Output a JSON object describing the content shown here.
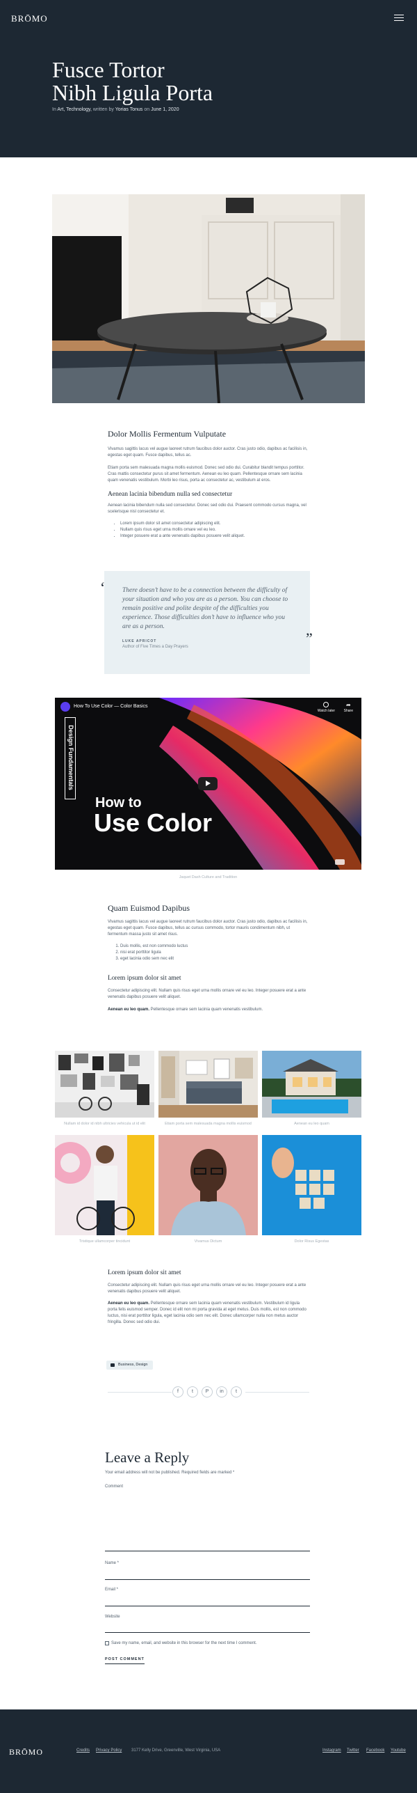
{
  "header": {
    "logo": "BRŌMO",
    "menu_icon": "hamburger-icon"
  },
  "post": {
    "title_line1": "Fusce Tortor",
    "title_line2": "Nibh Ligula Porta",
    "meta_in": "In",
    "categories": "Art, Technology,",
    "meta_written": "written by",
    "author": "Yorias Tonus",
    "meta_on": "on",
    "date": "June 1, 2020"
  },
  "section1": {
    "heading": "Dolor Mollis Fermentum Vulputate",
    "p1": "Vivamus sagittis lacus vel augue laoreet rutrum faucibus dolor auctor. Cras justo odio, dapibus ac facilisis in, egestas eget quam. Fusce dapibus, tellus ac.",
    "p2": "Etiam porta sem malesuada magna mollis euismod. Donec sed odio dui. Curabitur blandit tempus porttitor. Cras mattis consectetur purus sit amet fermentum. Aenean eu leo quam. Pellentesque ornare sem lacinia quam venenatis vestibulum. Morbi leo risus, porta ac consectetur ac, vestibulum at eros.",
    "subheading": "Aenean lacinia bibendum nulla sed consectetur",
    "p3": "Aenean lacinia bibendum nulla sed consectetur. Donec sed odio dui. Praesent commodo cursus magna, vel scelerisque nisl consectetur et.",
    "bullets": [
      "Lorem ipsum dolor sit amet consectetur adipiscing elit.",
      "Nullam quis risus eget urna mollis ornare vel eu leo.",
      "Integer posuere erat a ante venenatis dapibus posuere velit aliquet."
    ]
  },
  "quote": {
    "open_mark": "“",
    "close_mark": "”",
    "text": "There doesn’t have to be a connection between the difficulty of your situation and who you are as a person. You can choose to remain positive and polite despite of the difficulties you experience. Those difficulties don’t have to influence who you are as a person.",
    "name": "LUKE APRICOT",
    "role": "Author of Five Times a Day Prayers"
  },
  "video": {
    "channel_title": "How To Use Color — Color Basics",
    "watch_later": "Watch later",
    "share": "Share",
    "vertical_label": "Design Fundamentals",
    "overlay_line1": "How to",
    "overlay_line2": "Use Color",
    "caption": "Jaquet Dash Culture and Tradition"
  },
  "section2": {
    "heading": "Quam Euismod Dapibus",
    "p1": "Vivamus sagittis lacus vel augue laoreet rutrum faucibus dolor auctor. Cras justo odio, dapibus ac facilisis in, egestas eget quam. Fusce dapibus, tellus ac cursus commodo, tortor mauris condimentum nibh, ut fermentum massa justo sit amet risus.",
    "numbered": [
      "Duis mollis, est non commodo luctus",
      "nisi erat porttitor ligula",
      "eget lacinia odio sem nec elit"
    ],
    "subheading": "Lorem ipsum dolor sit amet",
    "p2": "Consectetur adipiscing elit. Nullam quis risus eget urna mollis ornare vel eu leo. Integer posuere erat a ante venenatis dapibus posuere velit aliquet.",
    "p3_bold": "Aenean eu leo quam.",
    "p3_rest": " Pellentesque ornare sem lacinia quam venenatis vestibulum."
  },
  "gallery": {
    "captions": [
      "Nullam id dolor id nibh ultricies vehicula ut id elit",
      "Etiam porta sem malesuada magna mollis euismod",
      "Aenean eu leo quam",
      "Tristique ullamcorper tincidunt",
      "Vivamus Dictum",
      "Dolor Risus Egestas"
    ]
  },
  "section3": {
    "subheading": "Lorem ipsum dolor sit amet",
    "p1": "Consectetur adipiscing elit. Nullam quis risus eget urna mollis ornare vel eu leo. Integer posuere erat a ante venenatis dapibus posuere velit aliquet.",
    "p2_bold": "Aenean eu leo quam.",
    "p2_rest": " Pellentesque ornare sem lacinia quam venenatis vestibulum. Vestibulum id ligula porta felis euismod semper. Donec id elit non mi porta gravida at eget metus. Duis mollis, est non commodo luctus, nisi erat porttitor ligula, eget lacinia odio sem nec elit. Donec ullamcorper nulla non metus auctor fringilla. Donec sed odio dui."
  },
  "tags": {
    "label": "Business, Design"
  },
  "share": {
    "icons": [
      "f",
      "t",
      "P",
      "in",
      "t"
    ]
  },
  "reply": {
    "title": "Leave a Reply",
    "note": "Your email address will not be published. Required fields are marked *",
    "comment_label": "Comment",
    "name_label": "Name *",
    "email_label": "Email *",
    "website_label": "Website",
    "save_label": "Save my name, email, and website in this browser for the next time I comment.",
    "submit": "POST COMMENT"
  },
  "footer": {
    "logo": "BRŌMO",
    "links_left": [
      "Credits",
      "Privacy Policy"
    ],
    "address": "3177 Kelly Drive, Greenville, West Virginia, USA",
    "links_right": [
      "Instagram",
      "Twitter",
      "Facebook",
      "Youtube"
    ]
  }
}
